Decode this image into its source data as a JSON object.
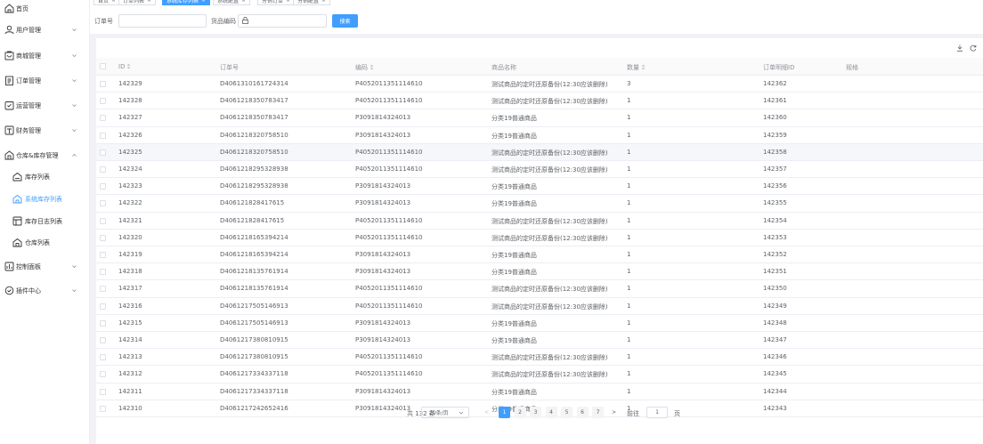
{
  "sidebar": {
    "items": [
      {
        "label": "首页",
        "icon": "home-icon",
        "arrow": false,
        "sub": false
      },
      {
        "label": "用户管理",
        "icon": "user-icon",
        "arrow": true,
        "sub": false
      },
      {
        "label": "商城管理",
        "icon": "shop-icon",
        "arrow": true,
        "sub": false
      },
      {
        "label": "订单管理",
        "icon": "order-icon",
        "arrow": true,
        "sub": false
      },
      {
        "label": "运营管理",
        "icon": "operation-icon",
        "arrow": true,
        "sub": false
      },
      {
        "label": "财务管理",
        "icon": "finance-icon",
        "arrow": true,
        "sub": false
      },
      {
        "label": "仓库&库存管理",
        "icon": "warehouse-icon",
        "arrow": true,
        "expanded": true,
        "sub": false
      },
      {
        "label": "库存列表",
        "icon": "inventory-icon",
        "arrow": false,
        "sub": true
      },
      {
        "label": "系统库存列表",
        "icon": "system-inventory-icon",
        "arrow": false,
        "sub": true,
        "active": true
      },
      {
        "label": "库存日志列表",
        "icon": "log-icon",
        "arrow": false,
        "sub": true
      },
      {
        "label": "仓库列表",
        "icon": "warehouse-list-icon",
        "arrow": false,
        "sub": true
      },
      {
        "label": "控制面板",
        "icon": "dashboard-icon",
        "arrow": true,
        "sub": false
      },
      {
        "label": "插件中心",
        "icon": "plugin-icon",
        "arrow": true,
        "sub": false
      }
    ]
  },
  "tabs": [
    {
      "label": "首页",
      "active": false
    },
    {
      "label": "订单列表",
      "active": false
    },
    {
      "label": "系统库存列表",
      "active": true
    },
    {
      "label": "系统配置",
      "active": false
    },
    {
      "label": "分销订单",
      "active": false
    },
    {
      "label": "分销配置",
      "active": false
    }
  ],
  "search": {
    "order_no_label": "订单号",
    "order_no_value": "",
    "goods_code_label": "货品编码",
    "goods_code_value": "",
    "search_button": "搜索"
  },
  "table": {
    "columns": [
      {
        "label": "ID",
        "sortable": true
      },
      {
        "label": "订单号",
        "sortable": false
      },
      {
        "label": "编码",
        "sortable": true
      },
      {
        "label": "商品名称",
        "sortable": false
      },
      {
        "label": "数量",
        "sortable": true
      },
      {
        "label": "订单明细ID",
        "sortable": false
      },
      {
        "label": "规格",
        "sortable": false
      }
    ],
    "rows": [
      [
        "142329",
        "D40613101617243​14",
        "P4052011351114610",
        "测试商品的定时还原备份(12:30应该删除)",
        "3",
        "142362",
        ""
      ],
      [
        "142328",
        "D4061218350783417",
        "P4052011351114610",
        "测试商品的定时还原备份(12:30应该删除)",
        "1",
        "142361",
        ""
      ],
      [
        "142327",
        "D4061218350783417",
        "P3091814324013",
        "分类19普通商品",
        "1",
        "142360",
        ""
      ],
      [
        "142326",
        "D4061218320758510",
        "P3091814324013",
        "分类19普通商品",
        "1",
        "142359",
        ""
      ],
      [
        "142325",
        "D4061218320758510",
        "P4052011351114610",
        "测试商品的定时还原备份(12:30应该删除)",
        "1",
        "142358",
        ""
      ],
      [
        "142324",
        "D4061218295328938",
        "P4052011351114610",
        "测试商品的定时还原备份(12:30应该删除)",
        "1",
        "142357",
        ""
      ],
      [
        "142323",
        "D4061218295328938",
        "P3091814324013",
        "分类19普通商品",
        "1",
        "142356",
        ""
      ],
      [
        "142322",
        "D406121828417615",
        "P3091814324013",
        "分类19普通商品",
        "1",
        "142355",
        ""
      ],
      [
        "142321",
        "D406121828417615",
        "P4052011351114610",
        "测试商品的定时还原备份(12:30应该删除)",
        "1",
        "142354",
        ""
      ],
      [
        "142320",
        "D4061218165394214",
        "P4052011351114610",
        "测试商品的定时还原备份(12:30应该删除)",
        "1",
        "142353",
        ""
      ],
      [
        "142319",
        "D4061218165394214",
        "P3091814324013",
        "分类19普通商品",
        "1",
        "142352",
        ""
      ],
      [
        "142318",
        "D4061218135761914",
        "P3091814324013",
        "分类19普通商品",
        "1",
        "142351",
        ""
      ],
      [
        "142317",
        "D4061218135761914",
        "P4052011351114610",
        "测试商品的定时还原备份(12:30应该删除)",
        "1",
        "142350",
        ""
      ],
      [
        "142316",
        "D4061217505146913",
        "P4052011351114610",
        "测试商品的定时还原备份(12:30应该删除)",
        "1",
        "142349",
        ""
      ],
      [
        "142315",
        "D4061217505146913",
        "P3091814324013",
        "分类19普通商品",
        "1",
        "142348",
        ""
      ],
      [
        "142314",
        "D4061217380810915",
        "P3091814324013",
        "分类19普通商品",
        "1",
        "142347",
        ""
      ],
      [
        "142313",
        "D4061217380810915",
        "P4052011351114610",
        "测试商品的定时还原备份(12:30应该删除)",
        "1",
        "142346",
        ""
      ],
      [
        "142312",
        "D4061217334337118",
        "P4052011351114610",
        "测试商品的定时还原备份(12:30应该删除)",
        "1",
        "142345",
        ""
      ],
      [
        "142311",
        "D4061217334337118",
        "P3091814324013",
        "分类19普通商品",
        "1",
        "142344",
        ""
      ],
      [
        "142310",
        "D4061217242652416",
        "P3091814324013",
        "分类19普通商品",
        "1",
        "142343",
        ""
      ]
    ],
    "hover_row": 4
  },
  "toolbar_icons": [
    "download-icon",
    "refresh-icon",
    "column-settings-icon"
  ],
  "pagination": {
    "total_text": "共 132 条",
    "page_size": "20条/页",
    "pages": [
      "1",
      "2",
      "3",
      "4",
      "5",
      "6",
      "7"
    ],
    "current_page": "1",
    "prev": "<",
    "next": ">",
    "goto_label": "前往",
    "goto_value": "1",
    "page_suffix": "页"
  },
  "colors": {
    "accent": "#409eff",
    "text": "#606266",
    "header_text": "#909399",
    "border": "#ebeef5"
  }
}
